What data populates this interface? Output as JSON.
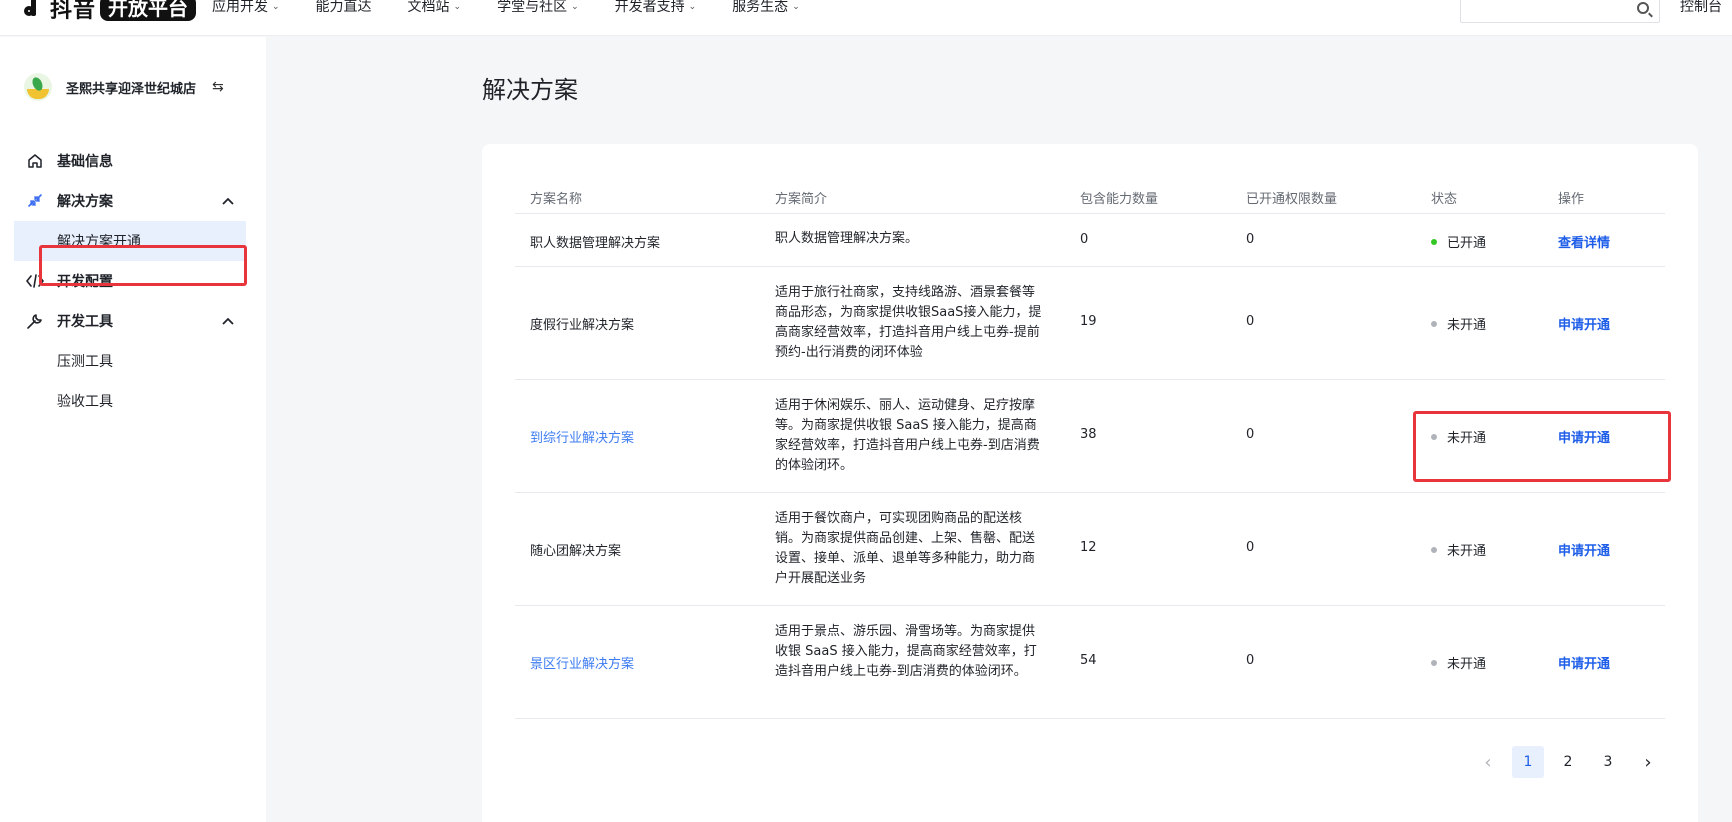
{
  "header": {
    "logo_text": "抖音",
    "logo_badge": "开放平台",
    "nav": [
      {
        "label": "应用开发",
        "has_dropdown": true
      },
      {
        "label": "能力直达",
        "has_dropdown": false
      },
      {
        "label": "文档站",
        "has_dropdown": true
      },
      {
        "label": "学堂与社区",
        "has_dropdown": true
      },
      {
        "label": "开发者支持",
        "has_dropdown": true
      },
      {
        "label": "服务生态",
        "has_dropdown": true
      }
    ],
    "search_placeholder": "",
    "console_label": "控制台"
  },
  "sidebar": {
    "store_name": "圣熙共享迎泽世纪城店",
    "menu": [
      {
        "label": "基础信息",
        "icon": "home-icon",
        "level": 1
      },
      {
        "label": "解决方案",
        "icon": "solution-icon",
        "level": 1,
        "expanded": true
      },
      {
        "label": "解决方案开通",
        "level": 2,
        "active": true
      },
      {
        "label": "开发配置",
        "icon": "code-icon",
        "level": 1
      },
      {
        "label": "开发工具",
        "icon": "wrench-icon",
        "level": 1,
        "expanded": true
      },
      {
        "label": "压测工具",
        "level": 2
      },
      {
        "label": "验收工具",
        "level": 2
      }
    ]
  },
  "main": {
    "title": "解决方案",
    "table": {
      "columns": [
        "方案名称",
        "方案简介",
        "包含能力数量",
        "已开通权限数量",
        "状态",
        "操作"
      ],
      "rows": [
        {
          "name": "职人数据管理解决方案",
          "name_link": false,
          "desc": "职人数据管理解决方案。",
          "abilities": "0",
          "granted": "0",
          "status": "已开通",
          "status_color": "#34c724",
          "action": "查看详情"
        },
        {
          "name": "度假行业解决方案",
          "name_link": false,
          "desc": "适用于旅行社商家，支持线路游、酒景套餐等商品形态，为商家提供收银SaaS接入能力，提高商家经营效率，打造抖音用户线上屯券-提前预约-出行消费的闭环体验",
          "abilities": "19",
          "granted": "0",
          "status": "未开通",
          "status_color": "#b0b4ba",
          "action": "申请开通"
        },
        {
          "name": "到综行业解决方案",
          "name_link": true,
          "desc": "适用于休闲娱乐、丽人、运动健身、足疗按摩等。为商家提供收银 SaaS 接入能力，提高商家经营效率，打造抖音用户线上屯券-到店消费的体验闭环。",
          "abilities": "38",
          "granted": "0",
          "status": "未开通",
          "status_color": "#b0b4ba",
          "action": "申请开通"
        },
        {
          "name": "随心团解决方案",
          "name_link": false,
          "desc": "适用于餐饮商户，可实现团购商品的配送核销。为商家提供商品创建、上架、售罄、配送设置、接单、派单、退单等多种能力，助力商户开展配送业务",
          "abilities": "12",
          "granted": "0",
          "status": "未开通",
          "status_color": "#b0b4ba",
          "action": "申请开通"
        },
        {
          "name": "景区行业解决方案",
          "name_link": true,
          "desc": "适用于景点、游乐园、滑雪场等。为商家提供收银 SaaS 接入能力，提高商家经营效率，打造抖音用户线上屯券-到店消费的体验闭环。",
          "abilities": "54",
          "granted": "0",
          "status": "未开通",
          "status_color": "#b0b4ba",
          "action": "申请开通"
        }
      ]
    },
    "pagination": {
      "pages": [
        "1",
        "2",
        "3"
      ],
      "current": "1"
    }
  },
  "colors": {
    "accent": "#1f5ee8",
    "link": "#3d7cf0",
    "highlight": "#e8353c"
  }
}
